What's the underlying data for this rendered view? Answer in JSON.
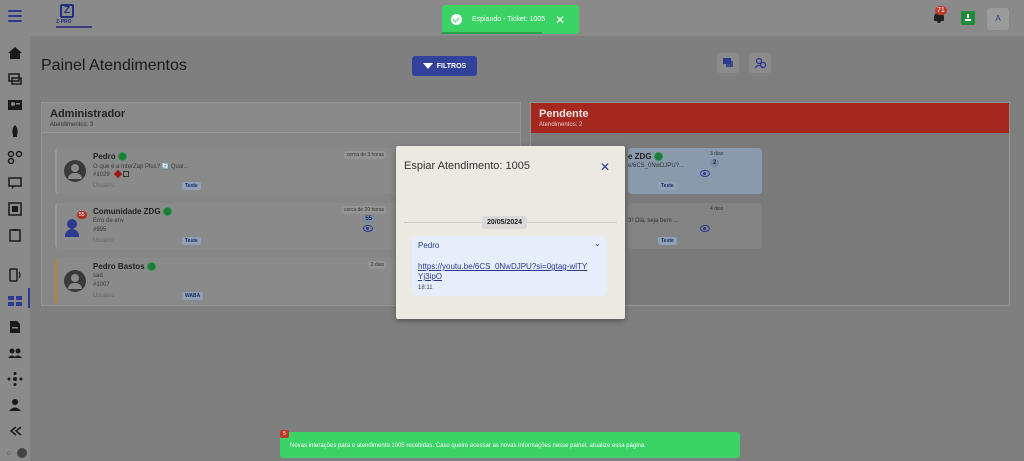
{
  "topbar": {
    "logo_text": "Z-PRO",
    "notifications_count": "71",
    "avatar_initial": "A"
  },
  "toast_top": {
    "message": "Espiando - Ticket: 1005",
    "close": "✕"
  },
  "page": {
    "title": "Painel Atendimentos",
    "filter_label": "FILTROS"
  },
  "columns": {
    "admin": {
      "title": "Administrador",
      "subtitle": "Atendimentos: 3",
      "tickets": [
        {
          "name": "Pedro",
          "message": "O que é a InterZap Plus? 🔄 Qual...",
          "number": "#1029",
          "user": "Usuário:",
          "tag": "Teste",
          "time": "cerca de 3 horas"
        },
        {
          "name": "Comunidade ZDG",
          "message": "Erro de env",
          "number": "#995",
          "user": "Usuário:",
          "tag": "Teste",
          "time": "cerca de 20 horas",
          "count": "55",
          "unread": "55"
        },
        {
          "name": "Pedro Bastos",
          "message": "sad",
          "number": "#1007",
          "user": "Usuário:",
          "tag": "WABA",
          "time": "2 dias"
        }
      ]
    },
    "pending": {
      "title": "Pendente",
      "subtitle": "Atendimentos: 2",
      "tickets": [
        {
          "name_partial": "e ZDG",
          "message": "e/6CS_0NwDJPU?...",
          "tag": "Teste",
          "time": "3 dias",
          "count": "2"
        },
        {
          "message": "3! Olá, seja bem ...",
          "tag": "Teste",
          "time": "4 dias"
        }
      ]
    }
  },
  "modal": {
    "title": "Espiar Atendimento: 1005",
    "close": "✕",
    "date": "20/05/2024",
    "message": {
      "sender": "Pedro",
      "link": "https://youtu.be/6CS_0NwDJPU?si=0gtag-wlTYYj3ipO",
      "time": "18:11"
    }
  },
  "toast_bottom": {
    "badge": "5",
    "message": "Novas interações para o atendimento 1005 recebidas. Caso queira acessar as novas informações nesse painel, atualize essa página."
  },
  "colors": {
    "accent": "#32419a",
    "toast_green": "#3bd266",
    "pending_red": "#a5281f"
  }
}
